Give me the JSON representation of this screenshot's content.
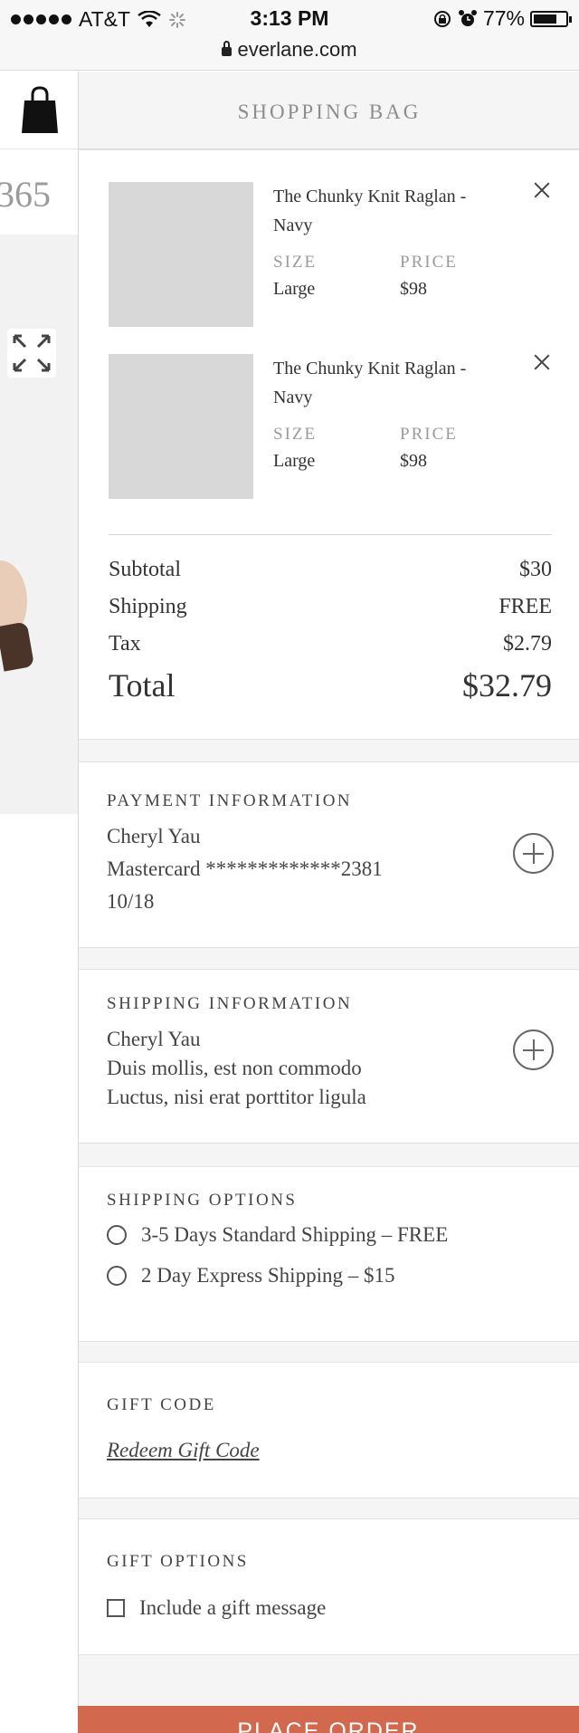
{
  "status_bar": {
    "carrier": "AT&T",
    "time": "3:13 PM",
    "battery": "77%",
    "battery_level": 0.77
  },
  "browser": {
    "url": "everlane.com"
  },
  "background_page": {
    "price_fragment": "365"
  },
  "bag": {
    "title": "SHOPPING BAG",
    "items": [
      {
        "name": "The Chunky Knit Raglan - Navy",
        "size_label": "SIZE",
        "size": "Large",
        "price_label": "PRICE",
        "price": "$98"
      },
      {
        "name": "The Chunky Knit Raglan - Navy",
        "size_label": "SIZE",
        "size": "Large",
        "price_label": "PRICE",
        "price": "$98"
      }
    ],
    "summary": {
      "subtotal_label": "Subtotal",
      "subtotal": "$30",
      "shipping_label": "Shipping",
      "shipping": "FREE",
      "tax_label": "Tax",
      "tax": "$2.79",
      "total_label": "Total",
      "total": "$32.79"
    }
  },
  "payment": {
    "title": "PAYMENT INFORMATION",
    "name": "Cheryl Yau",
    "card": "Mastercard *************2381",
    "expiry": "10/18"
  },
  "shipping_info": {
    "title": "SHIPPING INFORMATION",
    "name": "Cheryl Yau",
    "line1": "Duis mollis, est non commodo",
    "line2": "Luctus, nisi erat porttitor ligula"
  },
  "shipping_options": {
    "title": "SHIPPING OPTIONS",
    "options": [
      "3-5 Days Standard Shipping – FREE",
      "2 Day Express Shipping – $15"
    ]
  },
  "gift_code": {
    "title": "GIFT CODE",
    "link": "Redeem Gift Code"
  },
  "gift_options": {
    "title": "GIFT OPTIONS",
    "checkbox_label": "Include a gift message"
  },
  "cta": {
    "label": "PLACE ORDER"
  }
}
